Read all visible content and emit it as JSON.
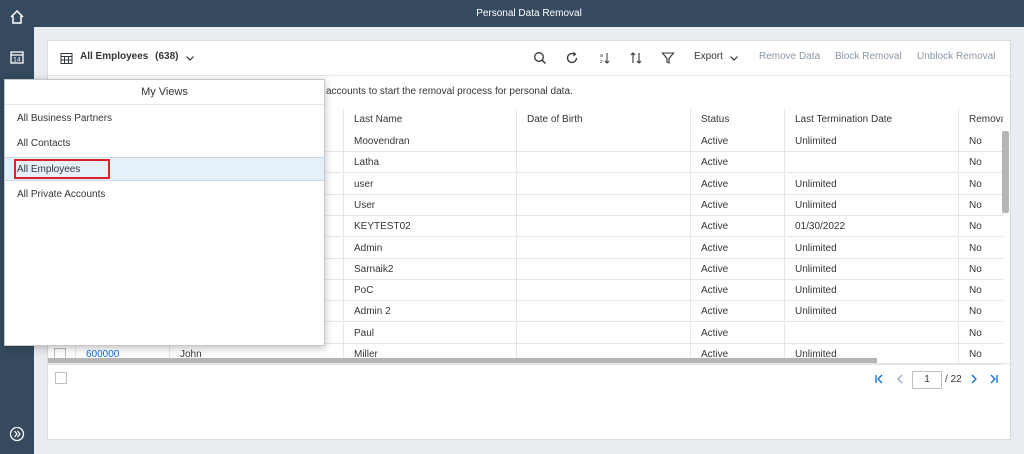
{
  "title": "Personal Data Removal",
  "toolbar": {
    "view_name": "All Employees",
    "count": "(638)",
    "export_label": "Export",
    "remove_label": "Remove Data",
    "block_label": "Block Removal",
    "unblock_label": "Unblock Removal"
  },
  "info_text": "accounts to start the removal process for personal data.",
  "columns": [
    "Last Name",
    "Date of Birth",
    "Status",
    "Last Termination Date",
    "Removal B"
  ],
  "rows": [
    {
      "last_name": "Moovendran",
      "dob": "",
      "status": "Active",
      "term": "Unlimited",
      "removal": "No"
    },
    {
      "last_name": "Latha",
      "dob": "",
      "status": "Active",
      "term": "",
      "removal": "No"
    },
    {
      "last_name": "user",
      "dob": "",
      "status": "Active",
      "term": "Unlimited",
      "removal": "No"
    },
    {
      "last_name": "User",
      "dob": "",
      "status": "Active",
      "term": "Unlimited",
      "removal": "No"
    },
    {
      "last_name": "KEYTEST02",
      "dob": "",
      "status": "Active",
      "term": "01/30/2022",
      "removal": "No"
    },
    {
      "last_name": "Admin",
      "dob": "",
      "status": "Active",
      "term": "Unlimited",
      "removal": "No"
    },
    {
      "last_name": "Sarnaik2",
      "dob": "",
      "status": "Active",
      "term": "Unlimited",
      "removal": "No"
    },
    {
      "last_name": "PoC",
      "dob": "",
      "status": "Active",
      "term": "Unlimited",
      "removal": "No"
    },
    {
      "last_name": "Admin 2",
      "dob": "",
      "status": "Active",
      "term": "Unlimited",
      "removal": "No"
    },
    {
      "last_name": "Paul",
      "dob": "",
      "status": "Active",
      "term": "",
      "removal": "No"
    },
    {
      "id": "600000",
      "first": "John",
      "last_name": "Miller",
      "dob": "",
      "status": "Active",
      "term": "Unlimited",
      "removal": "No"
    }
  ],
  "pager": {
    "page": "1",
    "total": "/ 22"
  },
  "dropdown": {
    "title": "My Views",
    "items": [
      "All Business Partners",
      "All Contacts",
      "All Employees",
      "All Private Accounts"
    ]
  },
  "colors": {
    "shell": "#354a5f",
    "accent": "#0a6ed1",
    "highlight": "#d9222a"
  }
}
